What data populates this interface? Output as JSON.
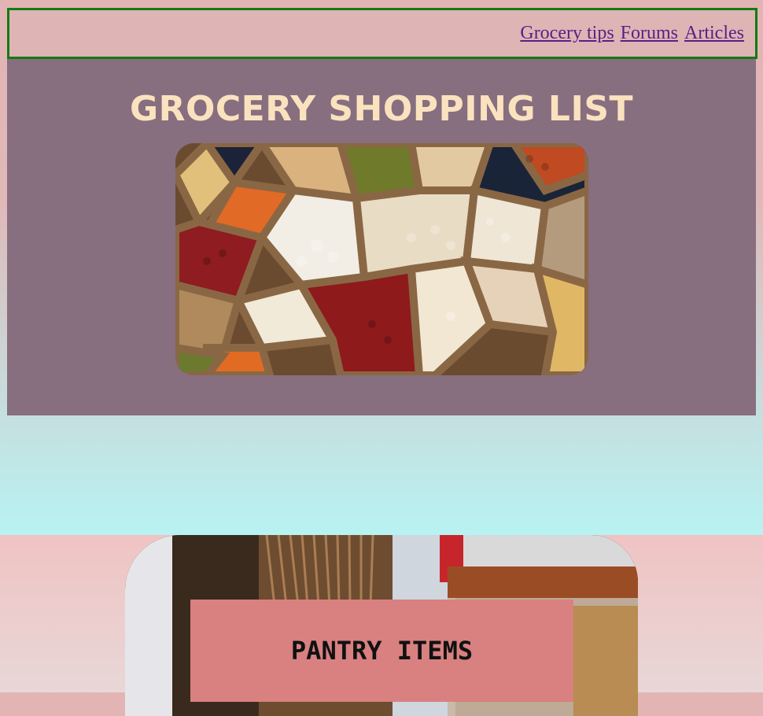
{
  "nav": {
    "links": [
      "Grocery tips",
      "Forums",
      "Articles"
    ]
  },
  "hero": {
    "title": "GROCERY SHOPPING LIST",
    "image_alt": "bean-assortment-photo"
  },
  "pantry": {
    "title": "PANTRY ITEMS",
    "image_alt": "pantry-shelves-photo"
  },
  "colors": {
    "hero_bg": "#876f80",
    "title": "#fbe2bf",
    "nav_border": "#137a13",
    "link": "#5a1f86",
    "pantry_box": "#d98080"
  }
}
